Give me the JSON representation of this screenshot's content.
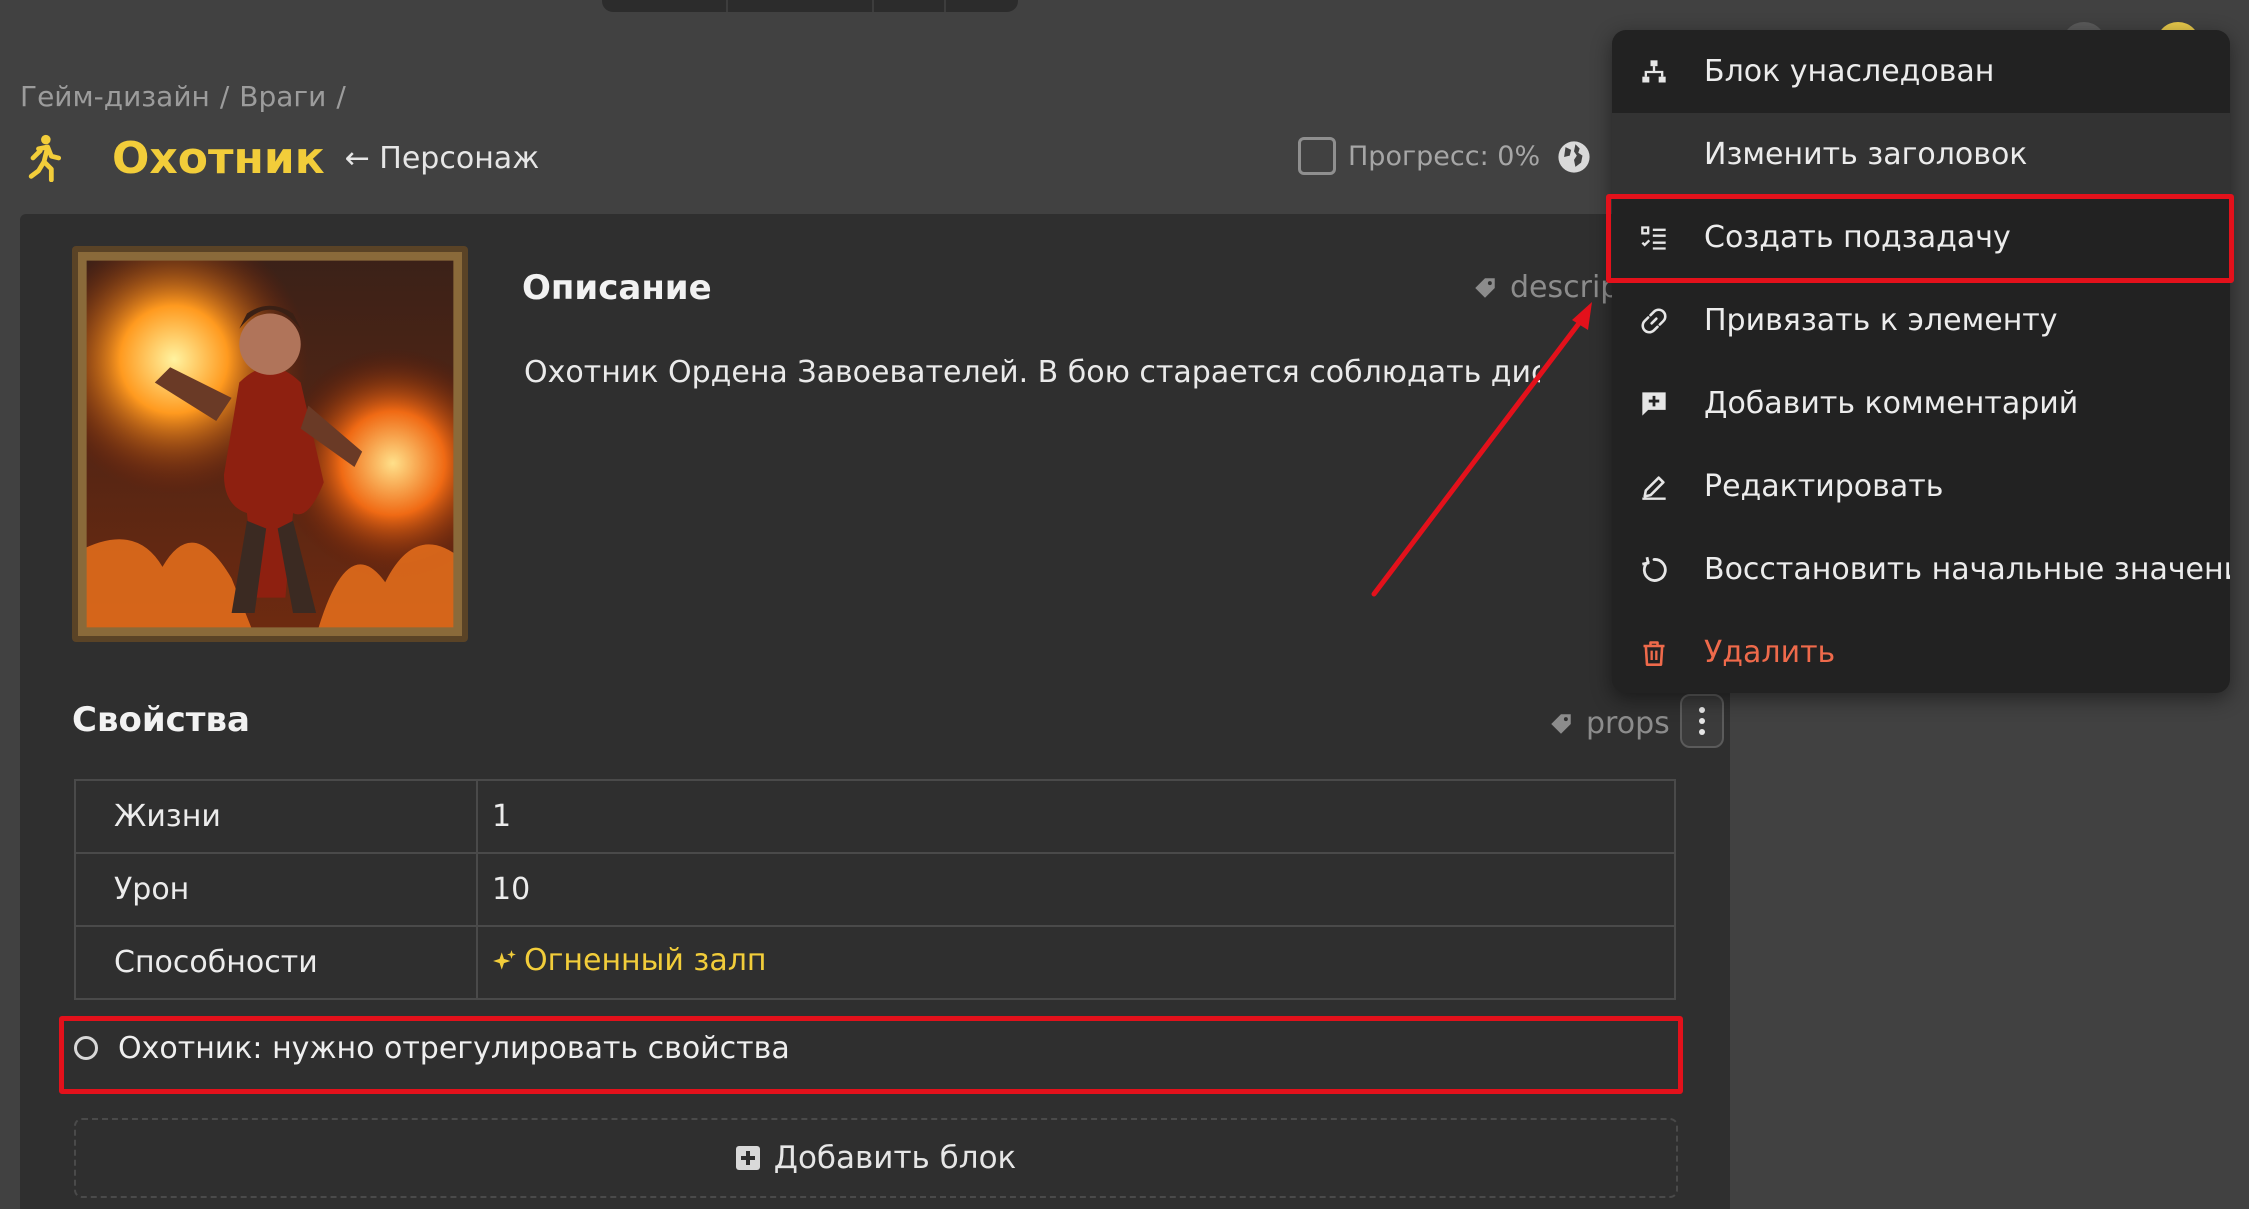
{
  "breadcrumb": [
    "Гейм-дизайн",
    "/",
    "Враги",
    "/"
  ],
  "page": {
    "title": "Охотник",
    "type_link": "← Персонаж",
    "progress_label": "Прогресс: 0%",
    "progress_value": 0
  },
  "description": {
    "title": "Описание",
    "tag": "descrip",
    "text": "Охотник Ордена Завоевателей. В бою старается соблюдать дистанцию"
  },
  "properties": {
    "title": "Свойства",
    "tag": "props",
    "rows": [
      {
        "key": "Жизни",
        "value": "1"
      },
      {
        "key": "Урон",
        "value": "10"
      },
      {
        "key": "Способности",
        "value": "Огненный залп"
      }
    ]
  },
  "subtask": {
    "label": "Охотник: нужно отрегулировать свойства"
  },
  "add_block_label": "Добавить блок",
  "context_menu": {
    "items": [
      {
        "label": "Блок унаследован",
        "icon": "hierarchy-icon"
      },
      {
        "label": "Изменить заголовок",
        "icon": "none"
      },
      {
        "label": "Создать подзадачу",
        "icon": "checklist-icon"
      },
      {
        "label": "Привязать к элементу",
        "icon": "link-icon"
      },
      {
        "label": "Добавить комментарий",
        "icon": "comment-plus-icon"
      },
      {
        "label": "Редактировать",
        "icon": "pencil-icon"
      },
      {
        "label": "Восстановить начальные значения",
        "icon": "reset-icon"
      },
      {
        "label": "Удалить",
        "icon": "trash-icon"
      }
    ]
  },
  "colors": {
    "accent": "#f2cd3a",
    "danger": "#ef6a4b",
    "annotation": "#e3111b",
    "background": "#414141",
    "card": "#2f2f2f",
    "menu": "#222222"
  }
}
